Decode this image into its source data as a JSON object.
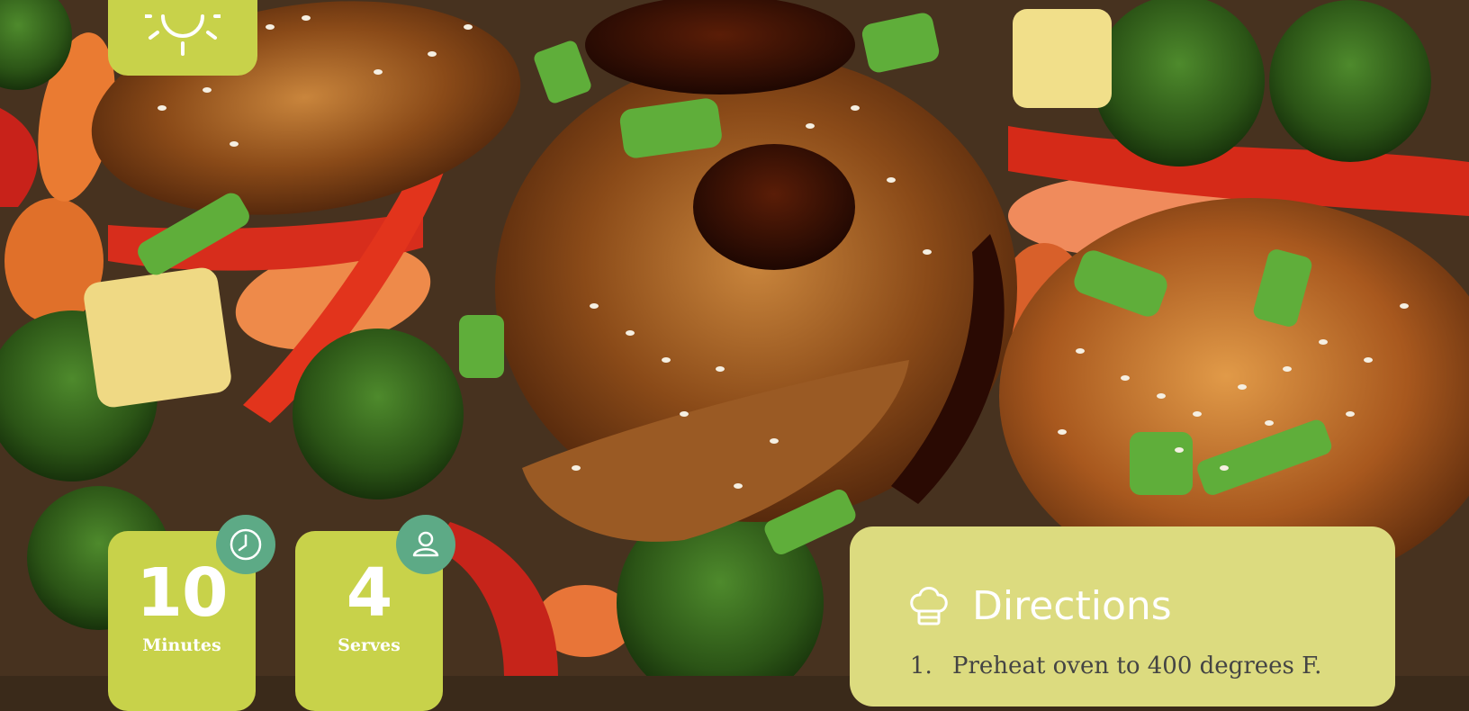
{
  "hero": {
    "image": "glazed-chicken-sheet-pan-photo"
  },
  "top_card": {
    "icon": "sun-icon"
  },
  "stats": [
    {
      "value": "10",
      "label": "Minutes",
      "icon": "clock-icon"
    },
    {
      "value": "4",
      "label": "Serves",
      "icon": "person-icon"
    }
  ],
  "directions": {
    "title": "Directions",
    "icon": "chef-hat-icon",
    "steps": [
      {
        "number": "1.",
        "text": "Preheat oven to 400 degrees F."
      }
    ]
  },
  "colors": {
    "card_green": "#c8d24a",
    "badge_green": "#5daa86",
    "directions_bg": "#dcdb7f"
  }
}
